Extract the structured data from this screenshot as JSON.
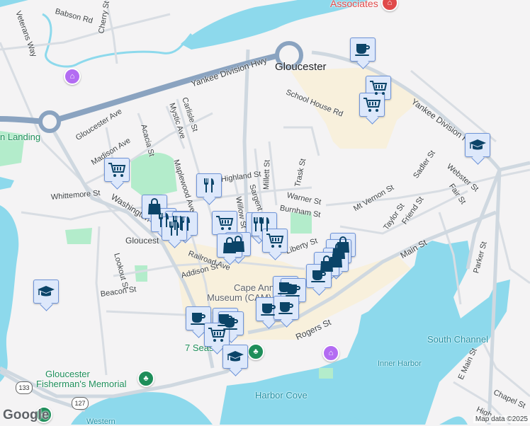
{
  "map": {
    "city_label": "Gloucester",
    "water_labels": [
      "South Channel",
      "Inner Harbor",
      "Harbor Cove",
      "Western"
    ],
    "street_labels": [
      "Yankee Division Hwy",
      "Yankee Division H",
      "Gloucester Ave",
      "Acacia St",
      "Mystic Ave",
      "Carlisle St",
      "Madison Ave",
      "Maplewood Ave",
      "Whittemore St",
      "Washington St",
      "Veterans Way",
      "Babson Rd",
      "Cherry St",
      "School House Rd",
      "Millett St",
      "Trask St",
      "Warner St",
      "Burnham St",
      "Sargent St",
      "Willow St",
      "Mt Vernon St",
      "Sadler St",
      "Webster St",
      "Fair St",
      "Taylor St",
      "Friend St",
      "Main St",
      "Parker St",
      "Rogers St",
      "Addison St",
      "Beacon St",
      "Lookout St",
      "Railroad Ave",
      "Liberty St",
      "E Main St",
      "Chapel St",
      "High",
      "Gloucest",
      "Highland St"
    ],
    "poi_labels": {
      "associates": "Associates",
      "landing": "n Landing",
      "memorial": "Gloucester\nFisherman's Memorial",
      "memorial_line1": "Gloucester",
      "memorial_line2": "Fisherman's Memorial",
      "museum": "Cape Ann Museum (CAM)",
      "museum_line1": "Cape Ann",
      "museum_line2": "Museum (CAM)",
      "seas": "7 Seas"
    },
    "route_shields": [
      "133",
      "127"
    ],
    "attribution": "Map data ©2025",
    "logo": "Google",
    "colors": {
      "water": "#8dd9ec",
      "land": "#f4f3f4",
      "park": "#b3eccb",
      "highway": "#8aa3c0",
      "marker_bg": "#dde8fb",
      "marker_icon": "#0b4468",
      "museum": "#b36cf2",
      "park_pin": "#1e8e5a"
    }
  },
  "markers": [
    "coffee",
    "cart",
    "cart",
    "graduation-cap",
    "cart",
    "restaurant",
    "shopping",
    "restaurant",
    "restaurant",
    "restaurant",
    "restaurant",
    "cart",
    "restaurant",
    "restaurant",
    "cart",
    "shopping",
    "shopping",
    "shopping",
    "shopping",
    "shopping",
    "shopping",
    "coffee",
    "coffee",
    "coffee",
    "coffee",
    "coffee",
    "coffee",
    "coffee",
    "coffee",
    "cart",
    "graduation-cap",
    "graduation-cap"
  ]
}
